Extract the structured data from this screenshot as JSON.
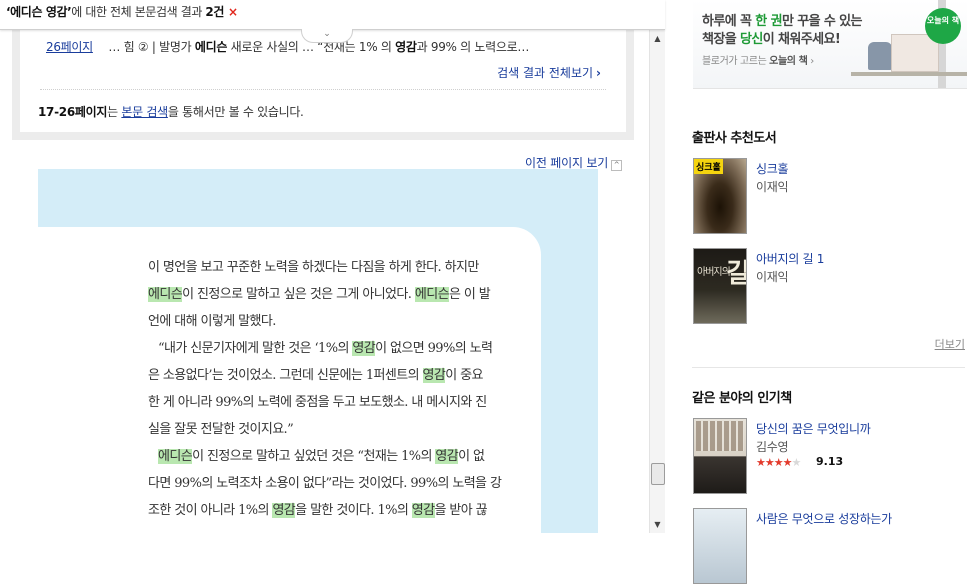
{
  "search_bar": {
    "query": "‘에디슨 영감’",
    "text": "에 대한 전체 본문검색 결과 ",
    "count": "2건",
    "close_glyph": "×"
  },
  "result": {
    "page_label": "26페이지",
    "fragment_pre": "… 힘 ② | 발명가 ",
    "fragment_kw1": "에디슨",
    "fragment_mid": " 새로운 사실의 … “천재는 1% 의 ",
    "fragment_kw2": "영감",
    "fragment_post": "과 99% 의 노력으로…",
    "see_all": "검색 결과 전체보기",
    "see_all_chevron": "›",
    "range_pages": "17-26페이지",
    "range_is": "는 ",
    "range_link": "본문 검색",
    "range_tail": "을 통해서만 볼 수 있습니다."
  },
  "prev_page": {
    "label": "이전 페이지 보기",
    "arrow": "^"
  },
  "book_page": {
    "l1": "이 명언을 보고 꾸준한 노력을 하겠다는 다짐을 하게 한다. 하지만",
    "l2_kw1": "에디슨",
    "l2_mid": "이 진정으로 말하고 싶은 것은 그게 아니었다. ",
    "l2_kw2": "에디슨",
    "l2_tail": "은 이 발",
    "l3": "언에 대해 이렇게 말했다.",
    "l4_pre": "“내가 신문기자에게 말한 것은 ‘1%의 ",
    "l4_kw": "영감",
    "l4_tail": "이 없으면 99%의 노력",
    "l5_pre": "은 소용없다’는 것이었소. 그런데 신문에는 1퍼센트의 ",
    "l5_kw": "영감",
    "l5_tail": "이 중요",
    "l6": "한 게 아니라 99%의 노력에 중점을 두고 보도했소. 내 메시지와 진",
    "l7": "실을 잘못 전달한 것이지요.”",
    "l8_kw1": "에디슨",
    "l8_mid": "이 진정으로 말하고 싶었던 것은 “천재는 1%의 ",
    "l8_kw2": "영감",
    "l8_tail": "이 없",
    "l9": "다면 99%의 노력조차 소용이 없다”라는 것이었다. 99%의 노력을 강",
    "l10_pre": "조한 것이 아니라 1%의 ",
    "l10_kw1": "영감",
    "l10_mid": "을 말한 것이다. 1%의 ",
    "l10_kw2": "영감",
    "l10_tail": "을 받아 끊"
  },
  "banner": {
    "line1_a": "하루에 꼭 ",
    "line1_b": "한 권",
    "line1_c": "만 꾸을 수 있는",
    "line2_a": "책장을 ",
    "line2_b": "당신",
    "line2_c": "이 채워주세요!",
    "sub_a": "블로거가 고르는 ",
    "sub_b": "오늘의 책",
    "sub_chev": " ›",
    "badge": "오늘의 책"
  },
  "publisher_recs": {
    "title": "출판사 추천도서",
    "books": [
      {
        "title": "싱크홀",
        "author": "이재익",
        "cover_tag": "싱크홀"
      },
      {
        "title": "아버지의 길 1",
        "author": "이재익",
        "cover_text": "아버지의",
        "cover_big": "길"
      }
    ],
    "more": "더보기"
  },
  "popular": {
    "title": "같은 분야의 인기책",
    "books": [
      {
        "title": "당신의 꿈은 무엇입니까",
        "author": "김수영",
        "rating": "9.13"
      },
      {
        "title": "사람은 무엇으로 성장하는가",
        "author": ""
      }
    ],
    "stars": "★★★★",
    "star_half": "★"
  },
  "scrollbar": {
    "up": "▲",
    "down": "▼"
  },
  "colors": {
    "link": "#1a3d9c",
    "highlight": "#b9e7b0",
    "page_bg": "#d4edf8",
    "close_red": "#e1261c",
    "banner_green": "#1e9a36"
  }
}
